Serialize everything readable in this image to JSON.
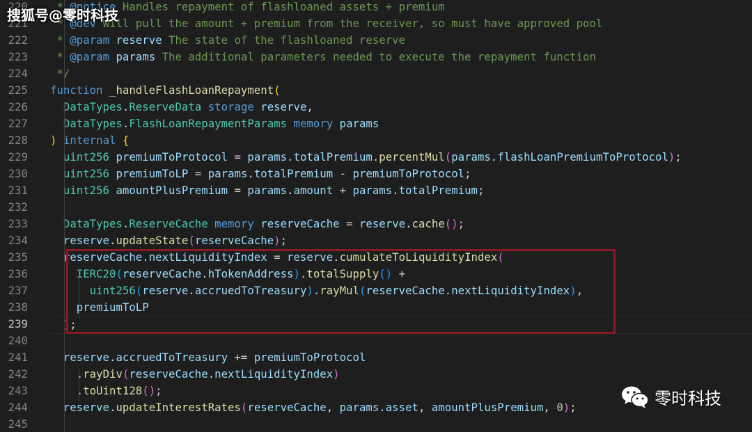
{
  "watermark_top": "搜狐号@零时科技",
  "watermark_bottom": {
    "text": "零时科技",
    "icon": "wechat-icon"
  },
  "colors": {
    "comment": "#6a9955",
    "keyword": "#569cd6",
    "control": "#c586c0",
    "type": "#4ec9b0",
    "function": "#dcdcaa",
    "variable": "#9cdcfe",
    "plain": "#d4d4d4",
    "number": "#b5cea8",
    "bracket1": "#ffd700",
    "bracket2": "#da70d6",
    "bracket3": "#179fff",
    "highlight_border": "#8b1a25"
  },
  "editor": {
    "current_line": "239",
    "lines": [
      {
        "num": "220",
        "tokens": [
          {
            "t": " * ",
            "c": "comment"
          },
          {
            "t": "@notice",
            "c": "keyword"
          },
          {
            "t": " Handles repayment of flashloaned assets + premium",
            "c": "comment"
          }
        ]
      },
      {
        "num": "221",
        "tokens": [
          {
            "t": " * ",
            "c": "comment"
          },
          {
            "t": "@dev",
            "c": "keyword"
          },
          {
            "t": " Will pull the amount + premium from the receiver, so must have approved pool",
            "c": "comment"
          }
        ]
      },
      {
        "num": "222",
        "tokens": [
          {
            "t": " * ",
            "c": "comment"
          },
          {
            "t": "@param",
            "c": "keyword"
          },
          {
            "t": " ",
            "c": "comment"
          },
          {
            "t": "reserve",
            "c": "variable"
          },
          {
            "t": " The state of the flashloaned reserve",
            "c": "comment"
          }
        ]
      },
      {
        "num": "223",
        "tokens": [
          {
            "t": " * ",
            "c": "comment"
          },
          {
            "t": "@param",
            "c": "keyword"
          },
          {
            "t": " ",
            "c": "comment"
          },
          {
            "t": "params",
            "c": "variable"
          },
          {
            "t": " The additional parameters needed to execute the repayment function",
            "c": "comment"
          }
        ]
      },
      {
        "num": "224",
        "tokens": [
          {
            "t": " */",
            "c": "comment"
          }
        ]
      },
      {
        "num": "225",
        "tokens": [
          {
            "t": "function",
            "c": "keyword"
          },
          {
            "t": " ",
            "c": "plain"
          },
          {
            "t": "_handleFlashLoanRepayment",
            "c": "function"
          },
          {
            "t": "(",
            "c": "bracket1"
          }
        ]
      },
      {
        "num": "226",
        "tokens": [
          {
            "t": "  ",
            "c": "plain"
          },
          {
            "t": "DataTypes",
            "c": "type"
          },
          {
            "t": ".",
            "c": "plain"
          },
          {
            "t": "ReserveData",
            "c": "type"
          },
          {
            "t": " ",
            "c": "plain"
          },
          {
            "t": "storage",
            "c": "keyword"
          },
          {
            "t": " ",
            "c": "plain"
          },
          {
            "t": "reserve",
            "c": "variable"
          },
          {
            "t": ",",
            "c": "plain"
          }
        ]
      },
      {
        "num": "227",
        "tokens": [
          {
            "t": "  ",
            "c": "plain"
          },
          {
            "t": "DataTypes",
            "c": "type"
          },
          {
            "t": ".",
            "c": "plain"
          },
          {
            "t": "FlashLoanRepaymentParams",
            "c": "type"
          },
          {
            "t": " ",
            "c": "plain"
          },
          {
            "t": "memory",
            "c": "keyword"
          },
          {
            "t": " ",
            "c": "plain"
          },
          {
            "t": "params",
            "c": "variable"
          }
        ]
      },
      {
        "num": "228",
        "tokens": [
          {
            "t": ")",
            "c": "bracket1"
          },
          {
            "t": " ",
            "c": "plain"
          },
          {
            "t": "internal",
            "c": "keyword"
          },
          {
            "t": " ",
            "c": "plain"
          },
          {
            "t": "{",
            "c": "bracket1"
          }
        ]
      },
      {
        "num": "229",
        "tokens": [
          {
            "t": "  ",
            "c": "plain"
          },
          {
            "t": "uint256",
            "c": "type"
          },
          {
            "t": " ",
            "c": "plain"
          },
          {
            "t": "premiumToProtocol",
            "c": "variable"
          },
          {
            "t": " = ",
            "c": "plain"
          },
          {
            "t": "params",
            "c": "variable"
          },
          {
            "t": ".",
            "c": "plain"
          },
          {
            "t": "totalPremium",
            "c": "variable"
          },
          {
            "t": ".",
            "c": "plain"
          },
          {
            "t": "percentMul",
            "c": "function"
          },
          {
            "t": "(",
            "c": "bracket2"
          },
          {
            "t": "params",
            "c": "variable"
          },
          {
            "t": ".",
            "c": "plain"
          },
          {
            "t": "flashLoanPremiumToProtocol",
            "c": "variable"
          },
          {
            "t": ")",
            "c": "bracket2"
          },
          {
            "t": ";",
            "c": "plain"
          }
        ]
      },
      {
        "num": "230",
        "tokens": [
          {
            "t": "  ",
            "c": "plain"
          },
          {
            "t": "uint256",
            "c": "type"
          },
          {
            "t": " ",
            "c": "plain"
          },
          {
            "t": "premiumToLP",
            "c": "variable"
          },
          {
            "t": " = ",
            "c": "plain"
          },
          {
            "t": "params",
            "c": "variable"
          },
          {
            "t": ".",
            "c": "plain"
          },
          {
            "t": "totalPremium",
            "c": "variable"
          },
          {
            "t": " - ",
            "c": "plain"
          },
          {
            "t": "premiumToProtocol",
            "c": "variable"
          },
          {
            "t": ";",
            "c": "plain"
          }
        ]
      },
      {
        "num": "231",
        "tokens": [
          {
            "t": "  ",
            "c": "plain"
          },
          {
            "t": "uint256",
            "c": "type"
          },
          {
            "t": " ",
            "c": "plain"
          },
          {
            "t": "amountPlusPremium",
            "c": "variable"
          },
          {
            "t": " = ",
            "c": "plain"
          },
          {
            "t": "params",
            "c": "variable"
          },
          {
            "t": ".",
            "c": "plain"
          },
          {
            "t": "amount",
            "c": "variable"
          },
          {
            "t": " + ",
            "c": "plain"
          },
          {
            "t": "params",
            "c": "variable"
          },
          {
            "t": ".",
            "c": "plain"
          },
          {
            "t": "totalPremium",
            "c": "variable"
          },
          {
            "t": ";",
            "c": "plain"
          }
        ]
      },
      {
        "num": "232",
        "tokens": []
      },
      {
        "num": "233",
        "tokens": [
          {
            "t": "  ",
            "c": "plain"
          },
          {
            "t": "DataTypes",
            "c": "type"
          },
          {
            "t": ".",
            "c": "plain"
          },
          {
            "t": "ReserveCache",
            "c": "type"
          },
          {
            "t": " ",
            "c": "plain"
          },
          {
            "t": "memory",
            "c": "keyword"
          },
          {
            "t": " ",
            "c": "plain"
          },
          {
            "t": "reserveCache",
            "c": "variable"
          },
          {
            "t": " = ",
            "c": "plain"
          },
          {
            "t": "reserve",
            "c": "variable"
          },
          {
            "t": ".",
            "c": "plain"
          },
          {
            "t": "cache",
            "c": "function"
          },
          {
            "t": "()",
            "c": "bracket2"
          },
          {
            "t": ";",
            "c": "plain"
          }
        ]
      },
      {
        "num": "234",
        "tokens": [
          {
            "t": "  ",
            "c": "plain"
          },
          {
            "t": "reserve",
            "c": "variable"
          },
          {
            "t": ".",
            "c": "plain"
          },
          {
            "t": "updateState",
            "c": "function"
          },
          {
            "t": "(",
            "c": "bracket2"
          },
          {
            "t": "reserveCache",
            "c": "variable"
          },
          {
            "t": ")",
            "c": "bracket2"
          },
          {
            "t": ";",
            "c": "plain"
          }
        ]
      },
      {
        "num": "235",
        "tokens": [
          {
            "t": "  ",
            "c": "plain"
          },
          {
            "t": "reserveCache",
            "c": "variable"
          },
          {
            "t": ".",
            "c": "plain"
          },
          {
            "t": "nextLiquidityIndex",
            "c": "variable"
          },
          {
            "t": " = ",
            "c": "plain"
          },
          {
            "t": "reserve",
            "c": "variable"
          },
          {
            "t": ".",
            "c": "plain"
          },
          {
            "t": "cumulateToLiquidityIndex",
            "c": "function"
          },
          {
            "t": "(",
            "c": "bracket2"
          }
        ]
      },
      {
        "num": "236",
        "tokens": [
          {
            "t": "    ",
            "c": "plain"
          },
          {
            "t": "IERC20",
            "c": "type"
          },
          {
            "t": "(",
            "c": "bracket3"
          },
          {
            "t": "reserveCache",
            "c": "variable"
          },
          {
            "t": ".",
            "c": "plain"
          },
          {
            "t": "hTokenAddress",
            "c": "variable"
          },
          {
            "t": ")",
            "c": "bracket3"
          },
          {
            "t": ".",
            "c": "plain"
          },
          {
            "t": "totalSupply",
            "c": "function"
          },
          {
            "t": "()",
            "c": "bracket3"
          },
          {
            "t": " +",
            "c": "plain"
          }
        ]
      },
      {
        "num": "237",
        "tokens": [
          {
            "t": "      ",
            "c": "plain"
          },
          {
            "t": "uint256",
            "c": "type"
          },
          {
            "t": "(",
            "c": "bracket3"
          },
          {
            "t": "reserve",
            "c": "variable"
          },
          {
            "t": ".",
            "c": "plain"
          },
          {
            "t": "accruedToTreasury",
            "c": "variable"
          },
          {
            "t": ")",
            "c": "bracket3"
          },
          {
            "t": ".",
            "c": "plain"
          },
          {
            "t": "rayMul",
            "c": "function"
          },
          {
            "t": "(",
            "c": "bracket3"
          },
          {
            "t": "reserveCache",
            "c": "variable"
          },
          {
            "t": ".",
            "c": "plain"
          },
          {
            "t": "nextLiquidityIndex",
            "c": "variable"
          },
          {
            "t": ")",
            "c": "bracket3"
          },
          {
            "t": ",",
            "c": "plain"
          }
        ]
      },
      {
        "num": "238",
        "tokens": [
          {
            "t": "    ",
            "c": "plain"
          },
          {
            "t": "premiumToLP",
            "c": "variable"
          }
        ]
      },
      {
        "num": "239",
        "tokens": [
          {
            "t": "  ",
            "c": "plain"
          },
          {
            "t": ")",
            "c": "bracket2"
          },
          {
            "t": ";",
            "c": "plain"
          }
        ]
      },
      {
        "num": "240",
        "tokens": []
      },
      {
        "num": "241",
        "tokens": [
          {
            "t": "  ",
            "c": "plain"
          },
          {
            "t": "reserve",
            "c": "variable"
          },
          {
            "t": ".",
            "c": "plain"
          },
          {
            "t": "accruedToTreasury",
            "c": "variable"
          },
          {
            "t": " += ",
            "c": "plain"
          },
          {
            "t": "premiumToProtocol",
            "c": "variable"
          }
        ]
      },
      {
        "num": "242",
        "tokens": [
          {
            "t": "    .",
            "c": "plain"
          },
          {
            "t": "rayDiv",
            "c": "function"
          },
          {
            "t": "(",
            "c": "bracket2"
          },
          {
            "t": "reserveCache",
            "c": "variable"
          },
          {
            "t": ".",
            "c": "plain"
          },
          {
            "t": "nextLiquidityIndex",
            "c": "variable"
          },
          {
            "t": ")",
            "c": "bracket2"
          }
        ]
      },
      {
        "num": "243",
        "tokens": [
          {
            "t": "    .",
            "c": "plain"
          },
          {
            "t": "toUint128",
            "c": "function"
          },
          {
            "t": "()",
            "c": "bracket2"
          },
          {
            "t": ";",
            "c": "plain"
          }
        ]
      },
      {
        "num": "244",
        "tokens": [
          {
            "t": "  ",
            "c": "plain"
          },
          {
            "t": "reserve",
            "c": "variable"
          },
          {
            "t": ".",
            "c": "plain"
          },
          {
            "t": "updateInterestRates",
            "c": "function"
          },
          {
            "t": "(",
            "c": "bracket2"
          },
          {
            "t": "reserveCache",
            "c": "variable"
          },
          {
            "t": ", ",
            "c": "plain"
          },
          {
            "t": "params",
            "c": "variable"
          },
          {
            "t": ".",
            "c": "plain"
          },
          {
            "t": "asset",
            "c": "variable"
          },
          {
            "t": ", ",
            "c": "plain"
          },
          {
            "t": "amountPlusPremium",
            "c": "variable"
          },
          {
            "t": ", ",
            "c": "plain"
          },
          {
            "t": "0",
            "c": "number"
          },
          {
            "t": ")",
            "c": "bracket2"
          },
          {
            "t": ";",
            "c": "plain"
          }
        ]
      },
      {
        "num": "245",
        "tokens": []
      }
    ]
  }
}
